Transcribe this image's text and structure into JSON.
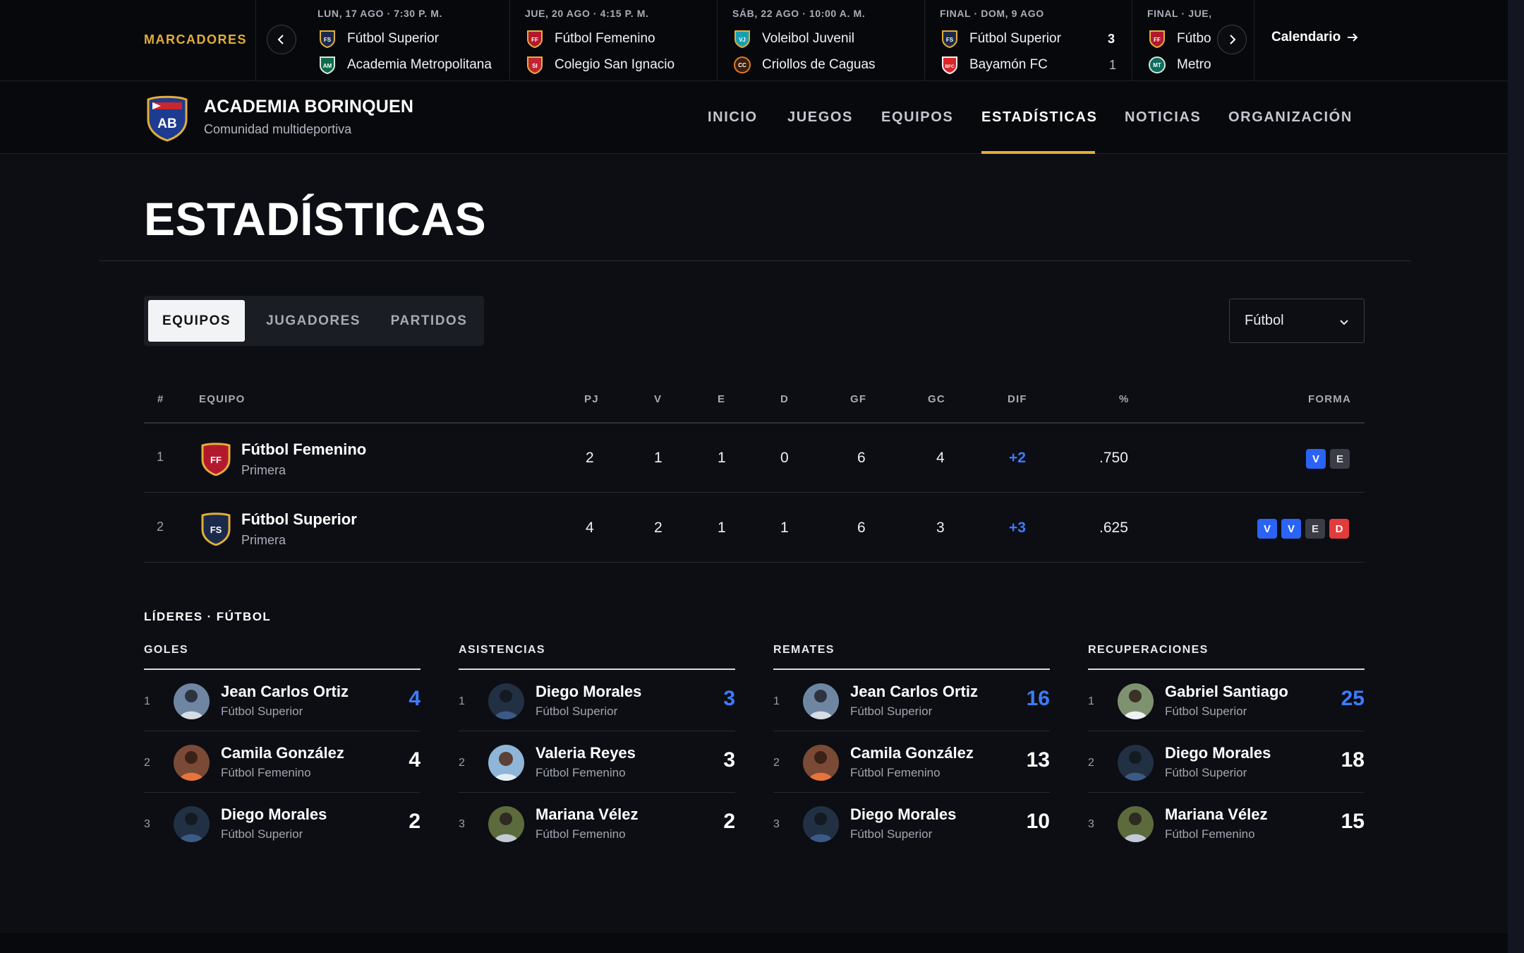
{
  "ticker": {
    "label": "MARCADORES",
    "calendar_label": "Calendario",
    "games": [
      {
        "head": "LUN, 17 AGO · 7:30 P. M.",
        "home": {
          "name": "Fútbol Superior",
          "crest": "FS"
        },
        "away": {
          "name": "Academia Metropolitana",
          "crest": "AM"
        }
      },
      {
        "head": "JUE, 20 AGO · 4:15 P. M.",
        "home": {
          "name": "Fútbol Femenino",
          "crest": "FF"
        },
        "away": {
          "name": "Colegio San Ignacio",
          "crest": "SI"
        }
      },
      {
        "head": "SÁB, 22 AGO · 10:00 A. M.",
        "home": {
          "name": "Voleibol Juvenil",
          "crest": "VJ"
        },
        "away": {
          "name": "Criollos de Caguas",
          "crest": "CC"
        }
      },
      {
        "head": "FINAL · DOM, 9 AGO",
        "home": {
          "name": "Fútbol Superior",
          "crest": "FS",
          "score": "3"
        },
        "away": {
          "name": "Bayamón FC",
          "crest": "BFC",
          "score": "1"
        }
      },
      {
        "head": "FINAL · JUE,",
        "home": {
          "name": "Fútbol",
          "crest": "FF"
        },
        "away": {
          "name": "Metro",
          "crest": "MT"
        }
      }
    ]
  },
  "brand": {
    "name": "ACADEMIA BORINQUEN",
    "subtitle": "Comunidad multideportiva",
    "crest_text": "AB"
  },
  "nav": {
    "items": [
      {
        "label": "INICIO"
      },
      {
        "label": "JUEGOS"
      },
      {
        "label": "EQUIPOS"
      },
      {
        "label": "ESTADÍSTICAS",
        "active": true
      },
      {
        "label": "NOTICIAS"
      },
      {
        "label": "ORGANIZACIÓN"
      }
    ]
  },
  "page": {
    "title": "ESTADÍSTICAS"
  },
  "tabs": [
    {
      "label": "EQUIPOS",
      "active": true
    },
    {
      "label": "JUGADORES"
    },
    {
      "label": "PARTIDOS"
    }
  ],
  "sport_select": {
    "value": "Fútbol"
  },
  "standings": {
    "columns": [
      "#",
      "EQUIPO",
      "PJ",
      "V",
      "E",
      "D",
      "GF",
      "GC",
      "DIF",
      "%",
      "FORMA"
    ],
    "rows": [
      {
        "rank": "1",
        "team": "Fútbol Femenino",
        "division": "Primera",
        "crest": "FF",
        "pj": "2",
        "v": "1",
        "e": "1",
        "d": "0",
        "gf": "6",
        "gc": "4",
        "dif": "+2",
        "pct": ".750",
        "form": [
          "V",
          "E"
        ]
      },
      {
        "rank": "2",
        "team": "Fútbol Superior",
        "division": "Primera",
        "crest": "FS",
        "pj": "4",
        "v": "2",
        "e": "1",
        "d": "1",
        "gf": "6",
        "gc": "3",
        "dif": "+3",
        "pct": ".625",
        "form": [
          "V",
          "V",
          "E",
          "D"
        ]
      }
    ]
  },
  "leaders": {
    "title": "LÍDERES · FÚTBOL",
    "categories": [
      {
        "label": "GOLES",
        "entries": [
          {
            "rank": "1",
            "name": "Jean Carlos Ortiz",
            "team": "Fútbol Superior",
            "value": "4"
          },
          {
            "rank": "2",
            "name": "Camila González",
            "team": "Fútbol Femenino",
            "value": "4"
          },
          {
            "rank": "3",
            "name": "Diego Morales",
            "team": "Fútbol Superior",
            "value": "2"
          }
        ]
      },
      {
        "label": "ASISTENCIAS",
        "entries": [
          {
            "rank": "1",
            "name": "Diego Morales",
            "team": "Fútbol Superior",
            "value": "3"
          },
          {
            "rank": "2",
            "name": "Valeria Reyes",
            "team": "Fútbol Femenino",
            "value": "3"
          },
          {
            "rank": "3",
            "name": "Mariana Vélez",
            "team": "Fútbol Femenino",
            "value": "2"
          }
        ]
      },
      {
        "label": "REMATES",
        "entries": [
          {
            "rank": "1",
            "name": "Jean Carlos Ortiz",
            "team": "Fútbol Superior",
            "value": "16"
          },
          {
            "rank": "2",
            "name": "Camila González",
            "team": "Fútbol Femenino",
            "value": "13"
          },
          {
            "rank": "3",
            "name": "Diego Morales",
            "team": "Fútbol Superior",
            "value": "10"
          }
        ]
      },
      {
        "label": "RECUPERACIONES",
        "entries": [
          {
            "rank": "1",
            "name": "Gabriel Santiago",
            "team": "Fútbol Superior",
            "value": "25"
          },
          {
            "rank": "2",
            "name": "Diego Morales",
            "team": "Fútbol Superior",
            "value": "18"
          },
          {
            "rank": "3",
            "name": "Mariana Vélez",
            "team": "Fútbol Femenino",
            "value": "15"
          }
        ]
      }
    ]
  },
  "colors": {
    "accent": "#e3ad3a",
    "blue": "#3d7bff",
    "win": "#2a63f5",
    "draw": "#3a3d46",
    "loss": "#e23b3b"
  }
}
